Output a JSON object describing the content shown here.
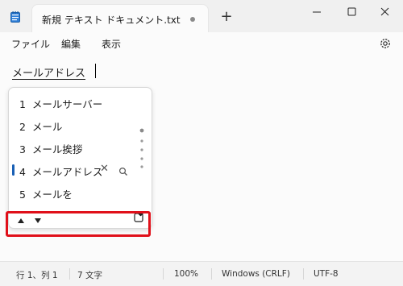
{
  "tab": {
    "title": "新規 テキスト ドキュメント.txt",
    "new_tab": "+"
  },
  "menu": {
    "file": "ファイル",
    "edit": "編集",
    "view": "表示"
  },
  "editor": {
    "composition_text": "メールアドレス"
  },
  "ime": {
    "candidates": [
      {
        "num": "1",
        "text": "メールサーバー"
      },
      {
        "num": "2",
        "text": "メール"
      },
      {
        "num": "3",
        "text": "メール挨拶"
      },
      {
        "num": "4",
        "text": "メールアドレス"
      },
      {
        "num": "5",
        "text": "メールを"
      }
    ],
    "selected_index": 3,
    "remove_glyph": "✕"
  },
  "status": {
    "position": "行 1、列 1",
    "chars": "7 文字",
    "zoom": "100%",
    "eol": "Windows (CRLF)",
    "encoding": "UTF-8"
  },
  "colors": {
    "highlight": "#e0101a",
    "accent": "#1a60b5"
  },
  "icons": [
    "notepad-icon",
    "unsaved-dot-icon",
    "minimize-icon",
    "maximize-icon",
    "close-icon",
    "gear-icon",
    "remove-icon",
    "search-icon",
    "up-arrow-icon",
    "down-arrow-icon",
    "favorite-icon"
  ]
}
